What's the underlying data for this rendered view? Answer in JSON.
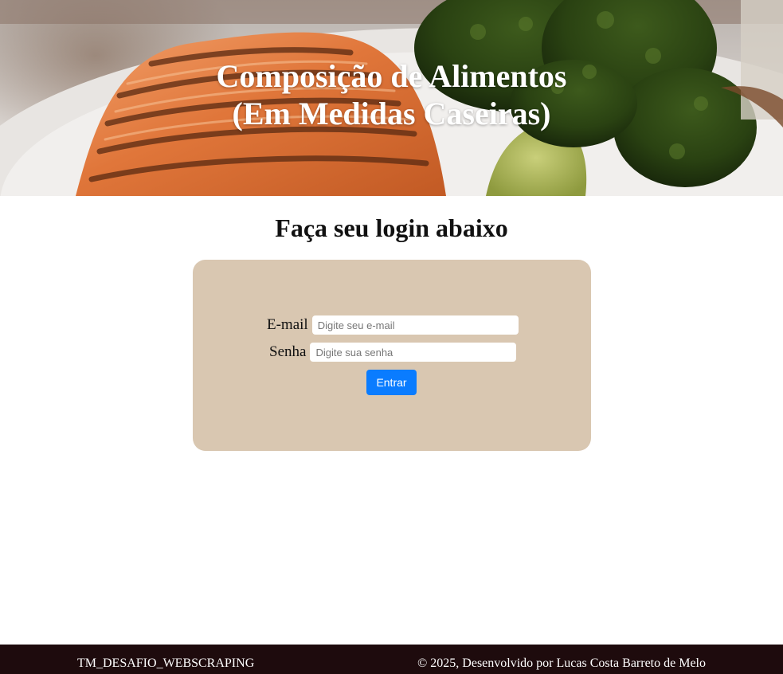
{
  "hero": {
    "title_line1": "Composição de Alimentos",
    "title_line2": "(Em Medidas Caseiras)"
  },
  "login": {
    "heading": "Faça seu login abaixo",
    "email_label": "E-mail",
    "email_placeholder": "Digite seu e-mail",
    "email_value": "",
    "password_label": "Senha",
    "password_placeholder": "Digite sua senha",
    "password_value": "",
    "submit_label": "Entrar"
  },
  "footer": {
    "left_text": "TM_DESAFIO_WEBSCRAPING",
    "right_text": "© 2025, Desenvolvido por Lucas Costa Barreto de Melo"
  },
  "colors": {
    "card_background": "#d9c7b1",
    "button_primary": "#0a7cff",
    "footer_background": "#1e0b0d"
  }
}
